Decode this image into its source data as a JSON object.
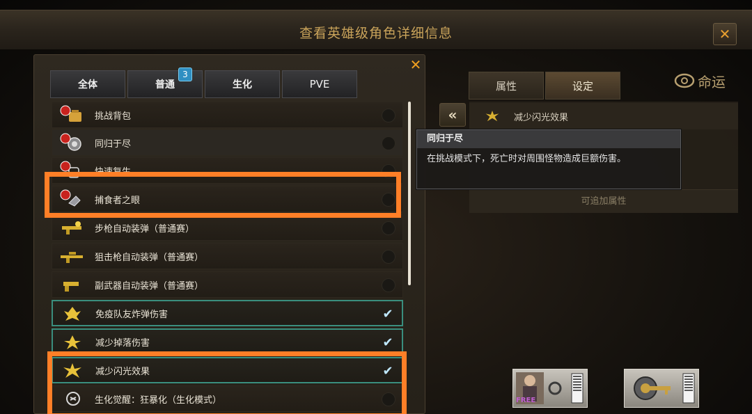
{
  "window": {
    "title": "查看英雄级角色详细信息",
    "close_glyph": "✕"
  },
  "dialog": {
    "close_glyph": "✕"
  },
  "tabs": [
    {
      "label": "全体"
    },
    {
      "label": "普通",
      "badge": "3"
    },
    {
      "label": "生化"
    },
    {
      "label": "PVE"
    }
  ],
  "list": {
    "items": [
      {
        "label": "挑战背包",
        "icon": "backpack-new-icon",
        "checked": false
      },
      {
        "label": "同归于尽",
        "icon": "bomb-new-icon",
        "checked": false
      },
      {
        "label": "快速复生",
        "icon": "revive-new-icon",
        "checked": false
      },
      {
        "label": "捕食者之眼",
        "icon": "eye-new-icon",
        "checked": false
      },
      {
        "label": "步枪自动装弹（普通赛）",
        "icon": "rifle-icon",
        "checked": false
      },
      {
        "label": "狙击枪自动装弹（普通赛）",
        "icon": "sniper-icon",
        "checked": false
      },
      {
        "label": "副武器自动装弹（普通赛）",
        "icon": "pistol-icon",
        "checked": false
      },
      {
        "label": "免疫队友炸弹伤害",
        "icon": "shield-bolt-icon",
        "checked": true
      },
      {
        "label": "减少掉落伤害",
        "icon": "fall-bolt-icon",
        "checked": true
      },
      {
        "label": "减少闪光效果",
        "icon": "flash-bolt-icon",
        "checked": true
      },
      {
        "label": "生化觉醒：狂暴化（生化模式）",
        "icon": "mutant-icon",
        "checked": false
      }
    ]
  },
  "right": {
    "tabs": [
      {
        "label": "属性"
      },
      {
        "label": "设定"
      }
    ],
    "logo_text": "命运",
    "collapse_glyph": "«",
    "selected_attr": {
      "label": "减少闪光效果",
      "icon": "flash-bolt-icon"
    },
    "addable_label": "可追加属性"
  },
  "tooltip": {
    "title": "同归于尽",
    "body": "在挑战模式下，死亡时对周围怪物造成巨额伤害。"
  },
  "bottom_items": [
    {
      "icon": "character-card-icon",
      "tag": "FREE"
    },
    {
      "icon": "key-card-icon"
    }
  ],
  "colors": {
    "highlight": "#ff7f27",
    "check": "#bfe8ff",
    "title": "#c9a35a"
  }
}
